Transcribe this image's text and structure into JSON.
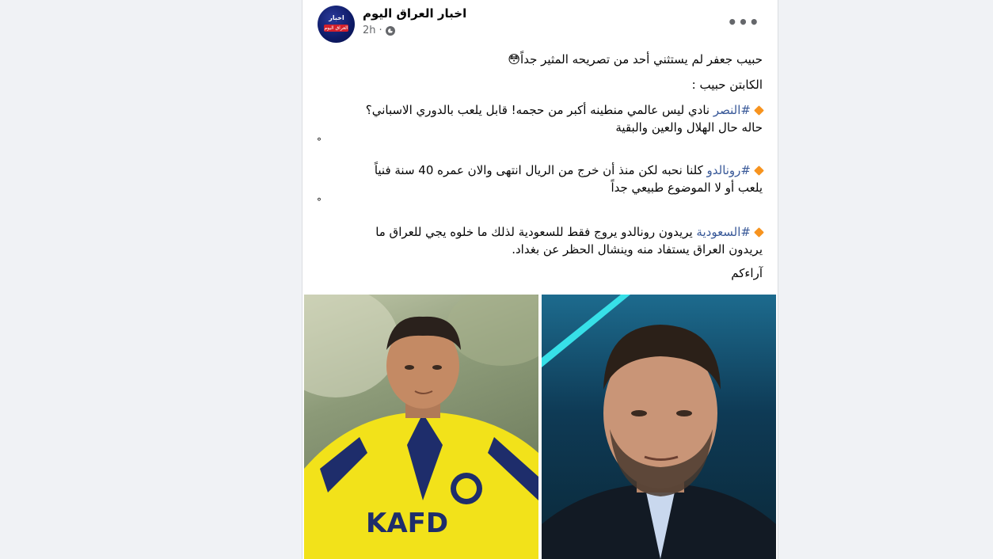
{
  "post": {
    "page_name": "اخبار العراق اليوم",
    "timestamp": "2h",
    "separator": "·",
    "avatar_text_top": "اخبار",
    "avatar_text_bar": "العراق اليوم",
    "more_label": "•••",
    "lines": {
      "l1": "حبيب جعفر لم يستثني أحد من تصريحه المثير جداً😳",
      "l2": "الكابتن حبيب :",
      "h1": "#النصر",
      "t1": " نادي ليس عالمي منطينه أكبر من حجمه! قابل يلعب بالدوري الاسباني؟",
      "t1b": "حاله حال الهلال والعين والبقية",
      "dot": "°",
      "h2": "#رونالدو",
      "t2": " كلنا نحبه لكن منذ أن خرج من الريال انتهى والان عمره 40 سنة فنياً",
      "t2b": "يلعب أو لا الموضوع طبيعي جداً",
      "h3": "#السعودية",
      "t3": " يريدون رونالدو يروج فقط للسعودية لذلك ما خلوه يجي للعراق ما",
      "t3b": "يريدون العراق يستفاد منه وينشال الحظر  عن بغداد.",
      "l_end": "آراءكم"
    },
    "colors": {
      "hashtag": "#385898",
      "diamond": "#f7931e",
      "kit_yellow": "#f5e51a",
      "kit_navy": "#1e2d6b"
    }
  }
}
